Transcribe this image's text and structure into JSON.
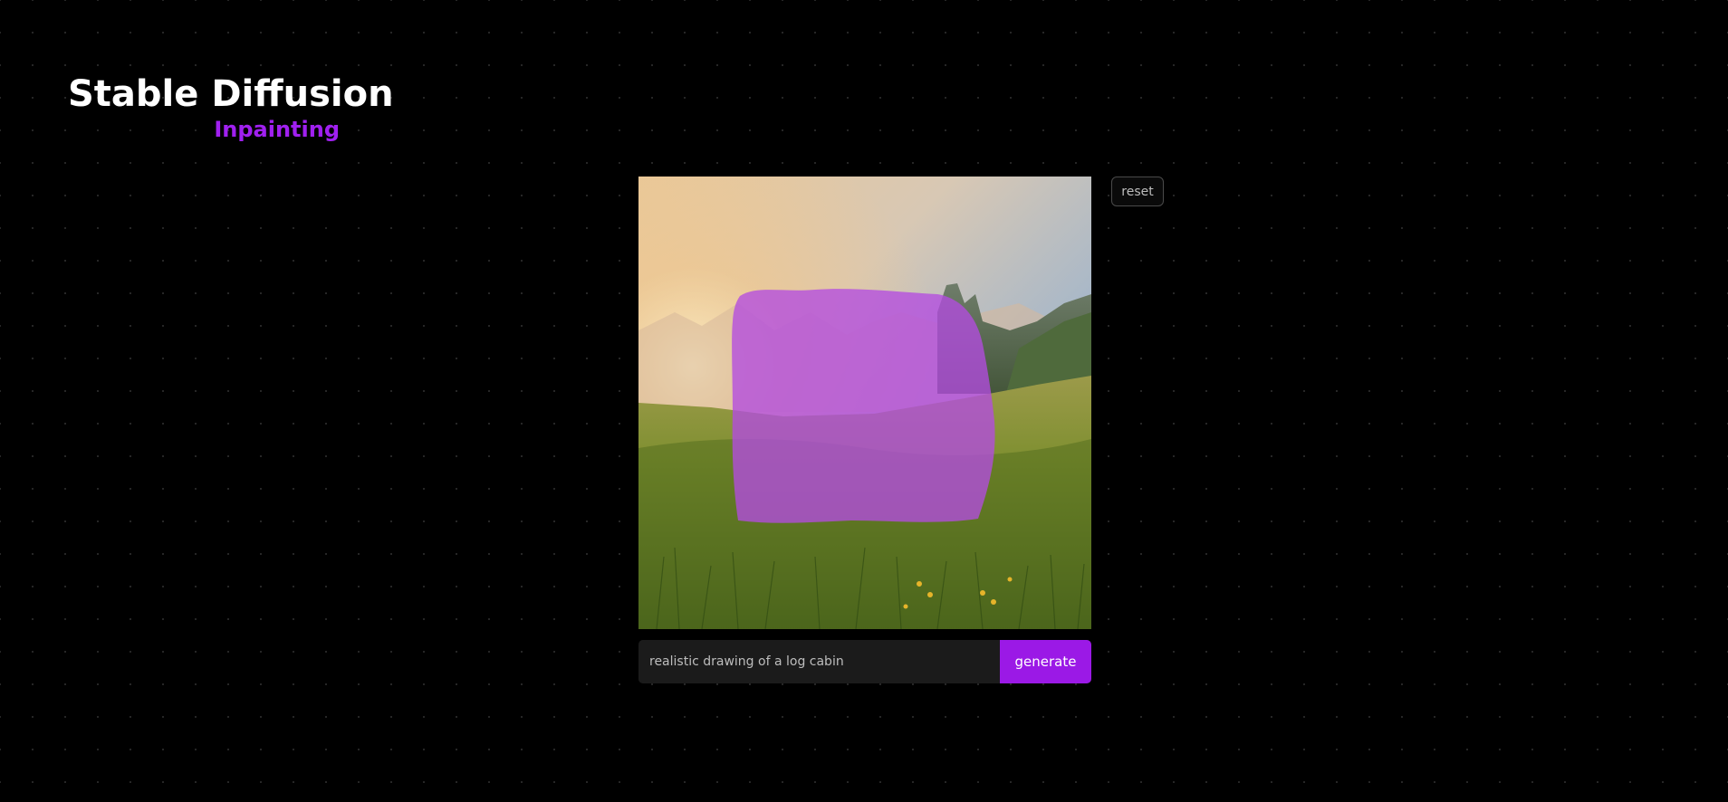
{
  "header": {
    "title": "Stable Diffusion",
    "subtitle": "Inpainting"
  },
  "canvas": {
    "image": "meadow-mountain-sunset-photo",
    "mask_color": "#b44be0"
  },
  "controls": {
    "reset_label": "reset",
    "prompt_value": "realistic drawing of a log cabin",
    "generate_label": "generate"
  },
  "colors": {
    "background": "#000000",
    "accent": "#a020f0",
    "button": "#9b19e6",
    "input_bg": "#1b1b1b"
  }
}
